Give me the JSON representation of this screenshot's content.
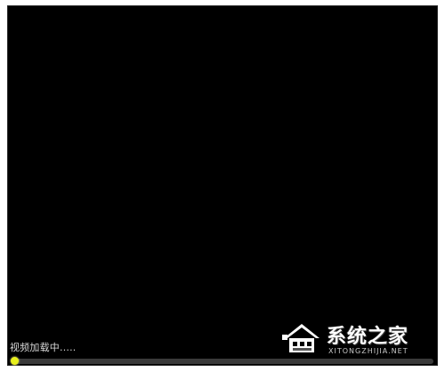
{
  "player": {
    "status_text": "视频加载中.....",
    "progress_fraction": 0.0
  },
  "watermark": {
    "brand_cn": "系统之家",
    "brand_en": "XITONGZHIJIA.NET",
    "logo_icon": "house-logo-icon"
  },
  "colors": {
    "background": "#000000",
    "knob": "#e8f01c",
    "track": "#3a3a3a"
  }
}
